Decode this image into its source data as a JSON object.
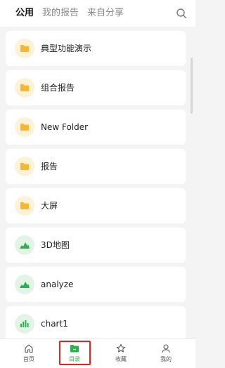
{
  "header": {
    "tabs": [
      {
        "label": "公用",
        "active": true
      },
      {
        "label": "我的报告",
        "active": false
      },
      {
        "label": "来自分享",
        "active": false
      }
    ],
    "search_icon": "search-icon"
  },
  "list": {
    "items": [
      {
        "label": "典型功能演示",
        "icon": "folder-icon"
      },
      {
        "label": "组合报告",
        "icon": "folder-icon"
      },
      {
        "label": "New Folder",
        "icon": "folder-icon"
      },
      {
        "label": "报告",
        "icon": "folder-icon"
      },
      {
        "label": "大屏",
        "icon": "folder-icon"
      },
      {
        "label": "3D地图",
        "icon": "mountain-chart-icon"
      },
      {
        "label": "analyze",
        "icon": "mountain-chart-icon"
      },
      {
        "label": "chart1",
        "icon": "bar-chart-icon"
      }
    ]
  },
  "tabbar": {
    "items": [
      {
        "label": "首页",
        "icon": "home-icon"
      },
      {
        "label": "目录",
        "icon": "directory-icon",
        "active": true
      },
      {
        "label": "收藏",
        "icon": "star-icon"
      },
      {
        "label": "我的",
        "icon": "user-icon"
      }
    ]
  },
  "colors": {
    "accent": "#2bb24c",
    "folder": "#f5b82e",
    "highlight": "#e0241f"
  }
}
